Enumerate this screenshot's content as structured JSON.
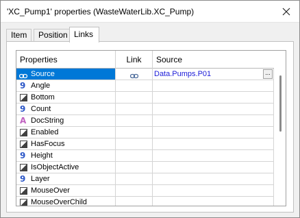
{
  "window": {
    "title": "'XC_Pump1' properties (WasteWaterLib.XC_Pump)"
  },
  "tabs": [
    {
      "label": "Item"
    },
    {
      "label": "Position"
    },
    {
      "label": "Links"
    }
  ],
  "grid": {
    "columns": {
      "properties": "Properties",
      "link": "Link",
      "source": "Source"
    },
    "rows": [
      {
        "name": "Source",
        "icon": "link-icon",
        "link_icon": "link-icon",
        "source": "Data.Pumps.P01",
        "selected": true
      },
      {
        "name": "Angle",
        "icon": "number-type-icon"
      },
      {
        "name": "Bottom",
        "icon": "boolean-type-icon"
      },
      {
        "name": "Count",
        "icon": "number-type-icon"
      },
      {
        "name": "DocString",
        "icon": "string-type-icon"
      },
      {
        "name": "Enabled",
        "icon": "boolean-type-icon"
      },
      {
        "name": "HasFocus",
        "icon": "boolean-type-icon"
      },
      {
        "name": "Height",
        "icon": "number-type-icon"
      },
      {
        "name": "IsObjectActive",
        "icon": "boolean-type-icon"
      },
      {
        "name": "Layer",
        "icon": "number-type-icon"
      },
      {
        "name": "MouseOver",
        "icon": "boolean-type-icon"
      },
      {
        "name": "MouseOverChild",
        "icon": "boolean-type-icon"
      }
    ],
    "ellipsis_label": "..."
  },
  "colors": {
    "selection": "#0078d7",
    "link_text": "#1a1ad8",
    "number_icon": "#2b56c7",
    "string_icon": "#c060c0"
  }
}
